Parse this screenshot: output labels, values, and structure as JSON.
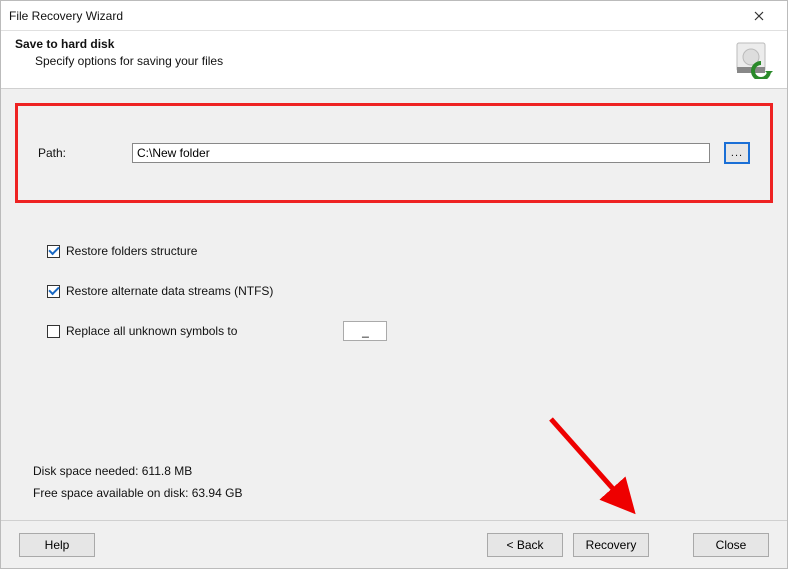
{
  "titlebar": {
    "title": "File Recovery Wizard"
  },
  "header": {
    "title": "Save to hard disk",
    "subtitle": "Specify options for saving your files"
  },
  "path": {
    "label": "Path:",
    "value": "C:\\New folder",
    "browse": "..."
  },
  "options": {
    "restore_folders": {
      "checked": true,
      "label": "Restore folders structure"
    },
    "restore_ads": {
      "checked": true,
      "label": "Restore alternate data streams (NTFS)"
    },
    "replace_symbols": {
      "checked": false,
      "label": "Replace all unknown symbols to",
      "value": "_"
    }
  },
  "disk": {
    "needed": "Disk space needed: 611.8 MB",
    "free": "Free space available on disk: 63.94 GB"
  },
  "footer": {
    "help": "Help",
    "back": "< Back",
    "recovery": "Recovery",
    "close": "Close"
  }
}
